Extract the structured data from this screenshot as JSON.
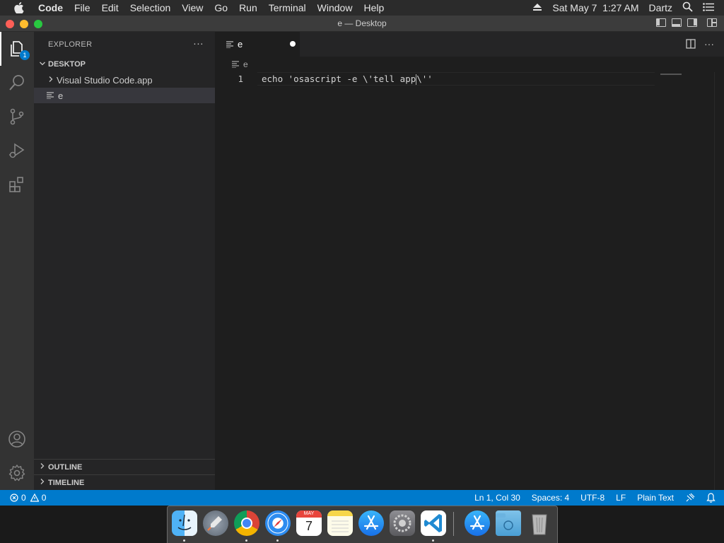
{
  "menubar": {
    "app_name": "Code",
    "items": [
      "File",
      "Edit",
      "Selection",
      "View",
      "Go",
      "Run",
      "Terminal",
      "Window",
      "Help"
    ],
    "datetime": "Sat May 7  1:27 AM",
    "user": "Dartz"
  },
  "window": {
    "title": "e — Desktop",
    "traffic_colors": [
      "#ff5f57",
      "#febc2e",
      "#28c840"
    ]
  },
  "activitybar": {
    "explorer_badge": "1",
    "icons": [
      "explorer-icon",
      "search-icon",
      "source-control-icon",
      "run-debug-icon",
      "extensions-icon",
      "account-icon",
      "settings-gear-icon"
    ]
  },
  "sidebar": {
    "header": "EXPLORER",
    "more": "···",
    "folder": "DESKTOP",
    "items": [
      {
        "label": "Visual Studio Code.app",
        "type": "folder"
      },
      {
        "label": "e",
        "type": "file"
      }
    ],
    "outline": "OUTLINE",
    "timeline": "TIMELINE"
  },
  "editor": {
    "tab_label": "e",
    "breadcrumb": "e",
    "line_number": "1",
    "code_before_cursor": "echo 'osascript -e \\'tell app",
    "code_after_cursor": "\\''"
  },
  "statusbar": {
    "errors": "0",
    "warnings": "0",
    "position": "Ln 1, Col 30",
    "spaces": "Spaces: 4",
    "encoding": "UTF-8",
    "eol": "LF",
    "language": "Plain Text"
  },
  "dock": {
    "apps": [
      "finder-icon",
      "launchpad-icon",
      "chrome-icon",
      "safari-icon",
      "calendar-icon",
      "notes-icon",
      "app-store-icon",
      "system-preferences-icon",
      "vscode-icon",
      "app-store-folder-icon",
      "downloads-folder-icon",
      "trash-icon"
    ],
    "calendar_month": "MAY",
    "calendar_day": "7"
  },
  "colors": {
    "accent": "#007acc",
    "editor_bg": "#1e1e1e",
    "sidebar_bg": "#252526"
  }
}
